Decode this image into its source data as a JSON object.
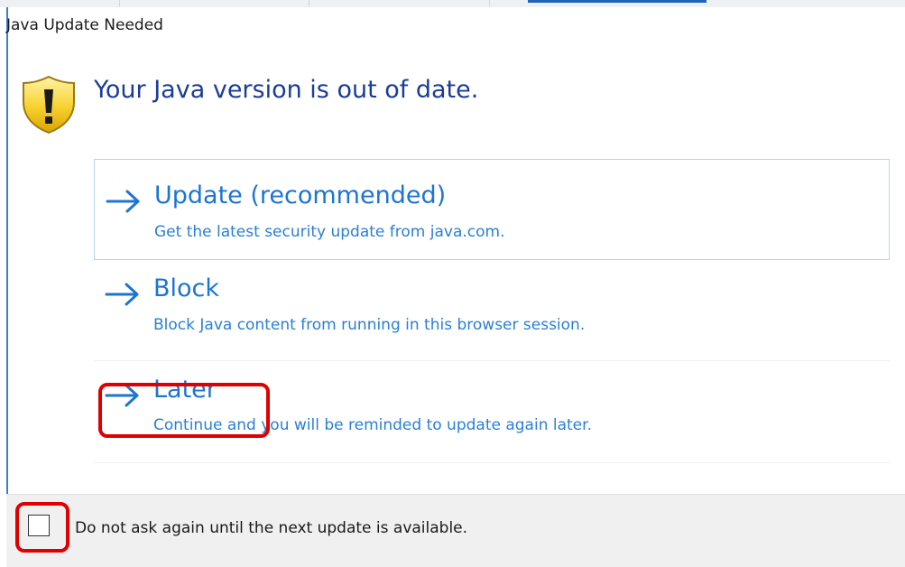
{
  "dialog": {
    "title": "Java Update Needed",
    "headline": "Your Java version is out of date.",
    "icon": "warning-shield-icon"
  },
  "options": [
    {
      "label": "Update (recommended)",
      "description": "Get the latest security update from java.com.",
      "icon": "arrow-right-icon"
    },
    {
      "label": "Block",
      "description": "Block Java content from running in this browser session.",
      "icon": "arrow-right-icon"
    },
    {
      "label": "Later",
      "description": "Continue and you will be reminded to update again later.",
      "icon": "arrow-right-icon"
    }
  ],
  "footer": {
    "checkbox_label": "Do not ask again until the next update is available.",
    "checkbox_checked": false
  },
  "colors": {
    "accent": "#1c75d1",
    "headline": "#1b3d96",
    "highlight": "#e00000"
  }
}
